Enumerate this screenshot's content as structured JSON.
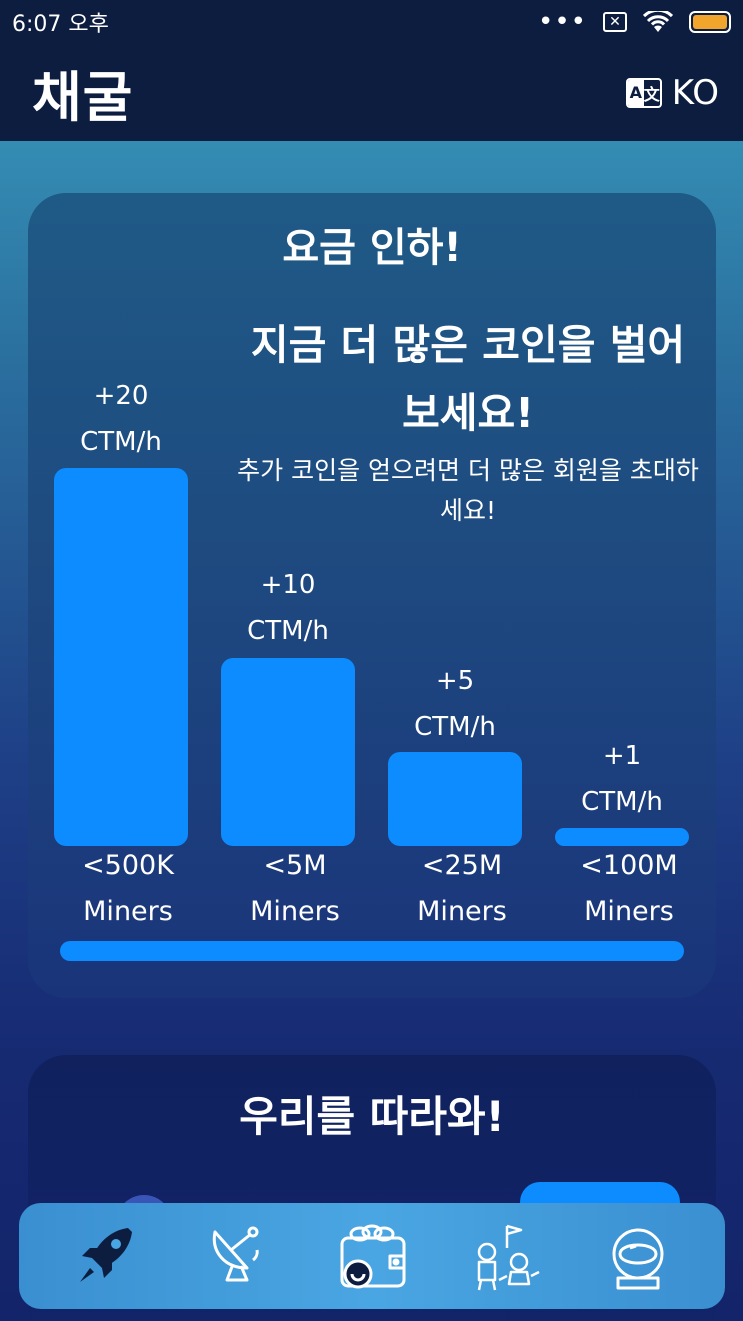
{
  "status_bar": {
    "time": "6:07 오후",
    "dots": "•••"
  },
  "header": {
    "title": "채굴",
    "lang_code": "KO",
    "lang_icon_a": "A",
    "lang_icon_b": "文"
  },
  "promo_card": {
    "title": "요금 인하!",
    "headline": "지금 더 많은 코인을 벌어보세요!",
    "subtext": "추가 코인을 얻으려면 더 많은 회원을 초대하세요!",
    "accent_color": "#0c8cff",
    "tiers": [
      {
        "amount": "+20",
        "unit": "CTM/h",
        "threshold": "<500K",
        "label": "Miners",
        "relative_rate": 20
      },
      {
        "amount": "+10",
        "unit": "CTM/h",
        "threshold": "<5M",
        "label": "Miners",
        "relative_rate": 10
      },
      {
        "amount": "+5",
        "unit": "CTM/h",
        "threshold": "<25M",
        "label": "Miners",
        "relative_rate": 5
      },
      {
        "amount": "+1",
        "unit": "CTM/h",
        "threshold": "<100M",
        "label": "Miners",
        "relative_rate": 1
      }
    ],
    "progress": 1.0
  },
  "follow_card": {
    "title": "우리를 따라와!"
  },
  "bottom_nav": {
    "items": [
      {
        "icon": "rocket-icon",
        "active": true
      },
      {
        "icon": "satellite-dish-icon",
        "active": false
      },
      {
        "icon": "wallet-icon",
        "active": false
      },
      {
        "icon": "astronauts-icon",
        "active": false
      },
      {
        "icon": "astronaut-helmet-icon",
        "active": false
      }
    ]
  }
}
